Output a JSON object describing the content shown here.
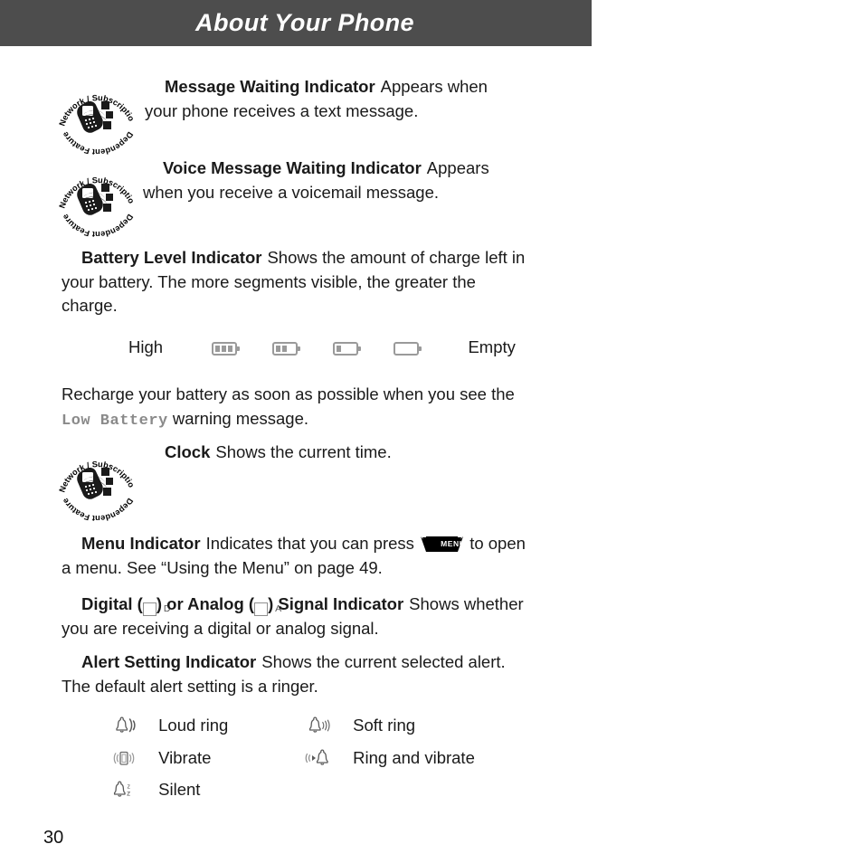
{
  "header": {
    "title": "About Your Phone"
  },
  "badge": {
    "top_text": "Network / Subscription",
    "bottom_text": "Dependent Feature",
    "name": "network-subscription-dependent-feature"
  },
  "entries": {
    "message_waiting": {
      "term": "Message Waiting Indicator",
      "desc": "Appears when your phone receives a text message."
    },
    "voice_message_waiting": {
      "term": "Voice Message Waiting Indicator",
      "desc": "Appears when you receive a voicemail message."
    },
    "battery_level": {
      "term": "Battery Level Indicator",
      "desc": "Shows the amount of charge left in your battery. The more segments visible, the greater the charge."
    },
    "clock": {
      "term": "Clock",
      "desc": "Shows the current time."
    },
    "menu_indicator": {
      "term": "Menu Indicator",
      "desc_before": "Indicates that you can press",
      "key_label": "MENU",
      "desc_after": "to open a menu. See “Using the Menu” on page 49."
    },
    "signal_indicator": {
      "term_part1": "Digital (",
      "digital_glyph": "D",
      "term_part2": ") or Analog (",
      "analog_glyph": "A",
      "term_part3": ") Signal Indicator",
      "desc": "Shows whether you are receiving a digital or analog signal."
    },
    "alert_setting": {
      "term": "Alert Setting Indicator",
      "desc": "Shows the current selected alert. The default alert setting is a ringer."
    }
  },
  "battery_scale": {
    "high_label": "High",
    "empty_label": "Empty",
    "levels": [
      3,
      2,
      1,
      0
    ]
  },
  "recharge_note": {
    "text_before": "Recharge your battery as soon as possible when you see the",
    "warning": "Low Battery",
    "text_after": "warning message."
  },
  "alert_list": [
    {
      "icon": "bell-loud-ring-icon",
      "label": "Loud ring"
    },
    {
      "icon": "bell-soft-ring-icon",
      "label": "Soft ring"
    },
    {
      "icon": "phone-vibrate-icon",
      "label": "Vibrate"
    },
    {
      "icon": "ring-and-vibrate-icon",
      "label": "Ring and vibrate"
    },
    {
      "icon": "bell-silent-icon",
      "label": "Silent"
    }
  ],
  "footer": {
    "page_number": "30"
  },
  "colors": {
    "header_bg": "#4d4d4d",
    "header_text": "#ffffff",
    "body_text": "#1a1a1a",
    "muted_gray": "#8a8a8a",
    "icon_gray": "#9a9a9a"
  }
}
